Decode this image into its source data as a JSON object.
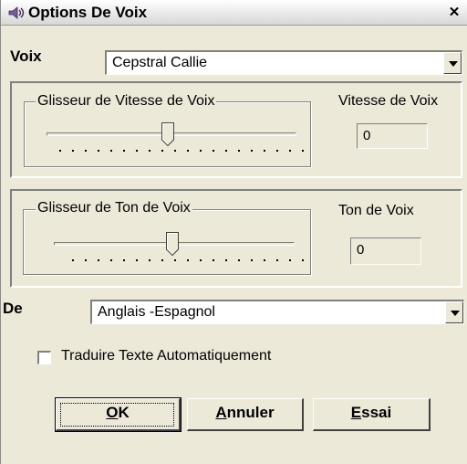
{
  "window": {
    "title": "Options De Voix",
    "close_glyph": "✕"
  },
  "voice": {
    "label": "Voix",
    "selected": "Cepstral Callie"
  },
  "speed": {
    "group_label": "Glisseur de Vitesse de Voix",
    "value_label": "Vitesse de Voix",
    "value": "0",
    "slider_level": 0.5
  },
  "pitch": {
    "group_label": "Glisseur de Ton de Voix",
    "value_label": "Ton de Voix",
    "value": "0",
    "slider_level": 0.5
  },
  "language": {
    "label": "De",
    "selected": "Anglais -Espagnol"
  },
  "translate": {
    "label": "Traduire Texte Automatiquement",
    "checked": false
  },
  "buttons": {
    "ok": {
      "mnemonic": "O",
      "rest": "K"
    },
    "cancel": {
      "mnemonic": "A",
      "rest": "nnuler"
    },
    "test": {
      "mnemonic": "E",
      "rest": "ssai"
    }
  },
  "icons": {
    "title": "speaker-icon",
    "dropdown": "chevron-down-icon"
  }
}
